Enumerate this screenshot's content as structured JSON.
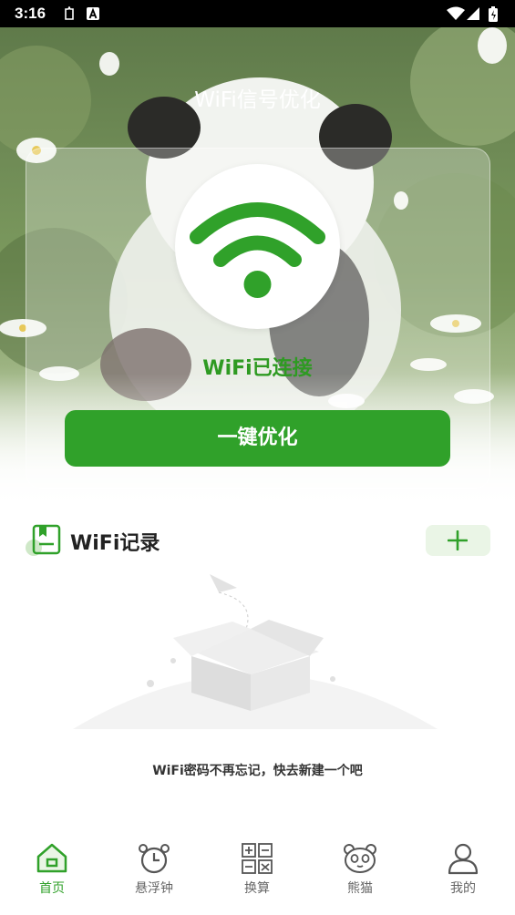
{
  "status_bar": {
    "time": "3:16"
  },
  "header": {
    "title": "WiFi信号优化"
  },
  "wifi_card": {
    "status_text": "WiFi已连接",
    "optimize_label": "一键优化"
  },
  "records": {
    "title": "WiFi记录",
    "add_icon": "plus-icon",
    "empty_text": "WiFi密码不再忘记，快去新建一个吧"
  },
  "bottom_nav": {
    "items": [
      {
        "label": "首页",
        "icon": "home-icon",
        "active": true
      },
      {
        "label": "悬浮钟",
        "icon": "alarm-clock-icon",
        "active": false
      },
      {
        "label": "换算",
        "icon": "calculator-icon",
        "active": false
      },
      {
        "label": "熊猫",
        "icon": "panda-icon",
        "active": false
      },
      {
        "label": "我的",
        "icon": "user-icon",
        "active": false
      }
    ]
  },
  "colors": {
    "accent": "#30a12a",
    "accent_light": "#eaf5e6",
    "inactive": "#666666"
  }
}
